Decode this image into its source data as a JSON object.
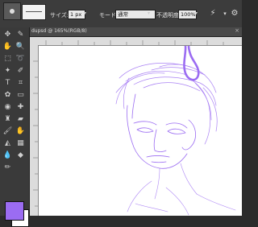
{
  "options_bar": {
    "size_label": "サイズ:",
    "size_value": "1 px",
    "mode_label": "モード:",
    "mode_value": "通常",
    "opacity_label": "不透明度:",
    "opacity_value": "100%"
  },
  "document": {
    "tab_title": "dupsd @ 165%(RGB/8)",
    "close_glyph": "×"
  },
  "toolbox": {
    "tools": [
      {
        "name": "move-tool",
        "glyph": "✥"
      },
      {
        "name": "eyedropper-tool",
        "glyph": "✎"
      },
      {
        "name": "hand-tool",
        "glyph": "✋"
      },
      {
        "name": "zoom-tool",
        "glyph": "🔍"
      },
      {
        "name": "marquee-tool",
        "glyph": "⬚"
      },
      {
        "name": "lasso-tool",
        "glyph": "➰"
      },
      {
        "name": "magic-wand-tool",
        "glyph": "✦"
      },
      {
        "name": "quick-selection-tool",
        "glyph": "✐"
      },
      {
        "name": "type-tool",
        "glyph": "T"
      },
      {
        "name": "crop-tool",
        "glyph": "⌗"
      },
      {
        "name": "shape-tool",
        "glyph": "✿"
      },
      {
        "name": "straighten-tool",
        "glyph": "▭"
      },
      {
        "name": "red-eye-tool",
        "glyph": "◉"
      },
      {
        "name": "healing-brush-tool",
        "glyph": "✚"
      },
      {
        "name": "clone-stamp-tool",
        "glyph": "♜"
      },
      {
        "name": "eraser-tool",
        "glyph": "▰"
      },
      {
        "name": "brush-tool",
        "glyph": "🖌"
      },
      {
        "name": "smudge-tool",
        "glyph": "✋"
      },
      {
        "name": "paint-bucket-tool",
        "glyph": "◭"
      },
      {
        "name": "gradient-tool",
        "glyph": "▦"
      },
      {
        "name": "blur-tool",
        "glyph": "💧"
      },
      {
        "name": "sponge-tool",
        "glyph": "◆"
      },
      {
        "name": "pencil-tool",
        "glyph": "✏"
      }
    ]
  },
  "colors": {
    "foreground": "#9b6cf2",
    "background": "#ffffff",
    "stroke": "#9b6cf2"
  }
}
